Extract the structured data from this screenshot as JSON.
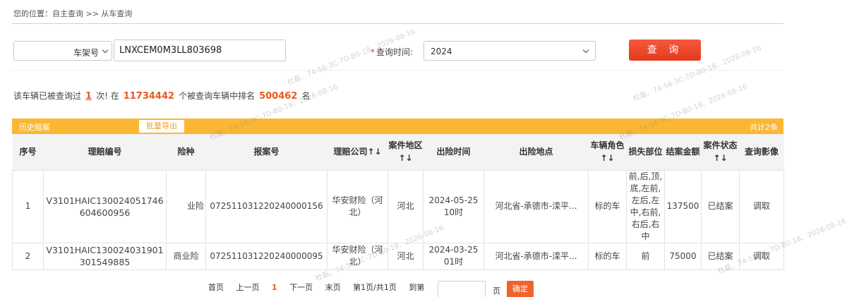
{
  "breadcrumb": "您的位置：自主查询 >> 从车查询",
  "query": {
    "type_value": "车架号",
    "vin_value": "LNXCEM0M3LL803698",
    "time_label": "查询时间:",
    "time_required_mark": "*",
    "year_value": "2024",
    "query_button": "查 询"
  },
  "stats": {
    "part1": "该车辆已被查询过",
    "times": "1",
    "part2": "次! 在",
    "total": "11734442",
    "part3": "个被查询车辆中排名",
    "rank": "500462",
    "part4": "名"
  },
  "panel": {
    "title": "历史赔案",
    "export_button": "批量导出",
    "total": "共计2条"
  },
  "table": {
    "headers": [
      "序号",
      "理赔编号",
      "险种",
      "报案号",
      "理赔公司↑↓",
      "案件地区↑↓",
      "出险时间",
      "出险地点",
      "车辆角色↑↓",
      "损失部位",
      "结案金额",
      "案件状态↑↓",
      "查询影像"
    ],
    "rows": [
      [
        "1",
        "V3101HAIC130024051746604600956",
        "业险",
        "072511031220240000156",
        "华安财险（河北）",
        "河北",
        "2024-05-25 10时",
        "河北省-承德市-滦平...",
        "标的车",
        "前,后,顶,底,左前,左后,左中,右前,右后,右中",
        "137500",
        "已结案",
        "调取"
      ],
      [
        "2",
        "V3101HAIC130024031901301549885",
        "商业险",
        "072511031220240000095",
        "华安财险（河北）",
        "河北",
        "2024-03-25 01时",
        "河北省-承德市-滦平...",
        "标的车",
        "前",
        "75000",
        "已结案",
        "调取"
      ]
    ]
  },
  "pager": {
    "first": "首页",
    "prev": "上一页",
    "current": "1",
    "next": "下一页",
    "last": "末页",
    "info": "第1页/共1页",
    "goto": "到第",
    "unit": "页",
    "ok": "确定"
  },
  "watermark": "杜磊、74-56-3C-7D-B0-18、2026-08-16"
}
